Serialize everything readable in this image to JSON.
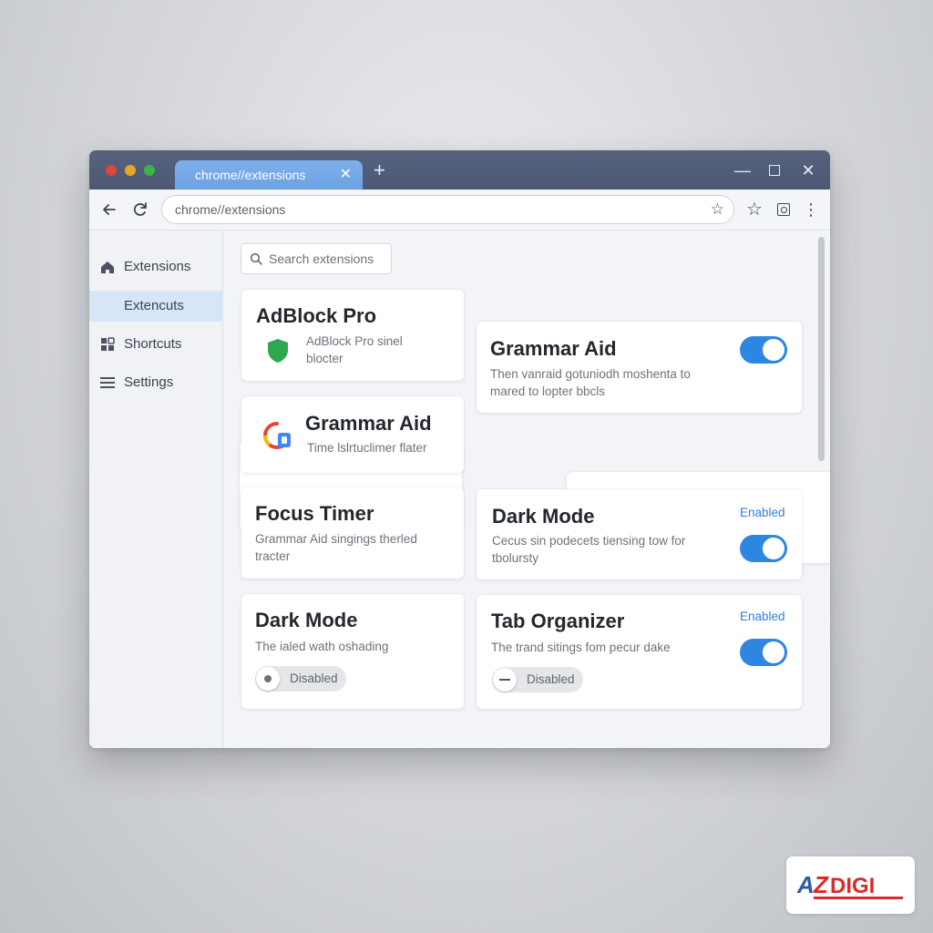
{
  "browser": {
    "tab_title": "chrome//extensions",
    "tab_close": "✕",
    "new_tab": "+",
    "address": "chrome//extensions",
    "win_min": "—",
    "win_close": "✕"
  },
  "sidebar": {
    "items": [
      {
        "label": "Extensions",
        "icon": "home-icon"
      },
      {
        "label": "Extencuts",
        "icon": "none",
        "active": true
      },
      {
        "label": "Shortcuts",
        "icon": "puzzle-icon"
      },
      {
        "label": "Settings",
        "icon": "menu-icon"
      }
    ]
  },
  "search": {
    "placeholder": "Search extensions"
  },
  "cards": {
    "adblock": {
      "title": "AdBlock Pro",
      "desc": "AdBlock Pro sinel blocter"
    },
    "grammar_left": {
      "title": "Grammar Aid",
      "desc": "Time lslrtuclimer flater"
    },
    "grammar_right": {
      "title": "Grammar Aid",
      "desc": "Then vanraid gotuniodh moshenta to mared to lopter bbcls",
      "toggle": "on"
    },
    "focus": {
      "title": "Focus Timer",
      "desc": "Grammar Aid singings therled tracter"
    },
    "darkmode_right": {
      "title": "Dark Mode",
      "desc": "Cecus sin podecets tiensing tow for tbolursty",
      "status": "Enabled",
      "toggle": "on"
    },
    "darkmode_left": {
      "title": "Dark Mode",
      "desc": "The ialed wath oshading",
      "status": "Disabled"
    },
    "tab_organizer": {
      "title": "Tab Organizer",
      "desc": "The trand sitings fom pecur dake",
      "status_enabled": "Enabled",
      "status_disabled": "Disabled",
      "toggle": "on"
    }
  },
  "logo": {
    "text": "AZDIGI"
  },
  "colors": {
    "accent": "#2d86e0",
    "titlebar": "#4c5874",
    "active_tab": "#6aa2e3",
    "shield": "#2ea84f"
  }
}
